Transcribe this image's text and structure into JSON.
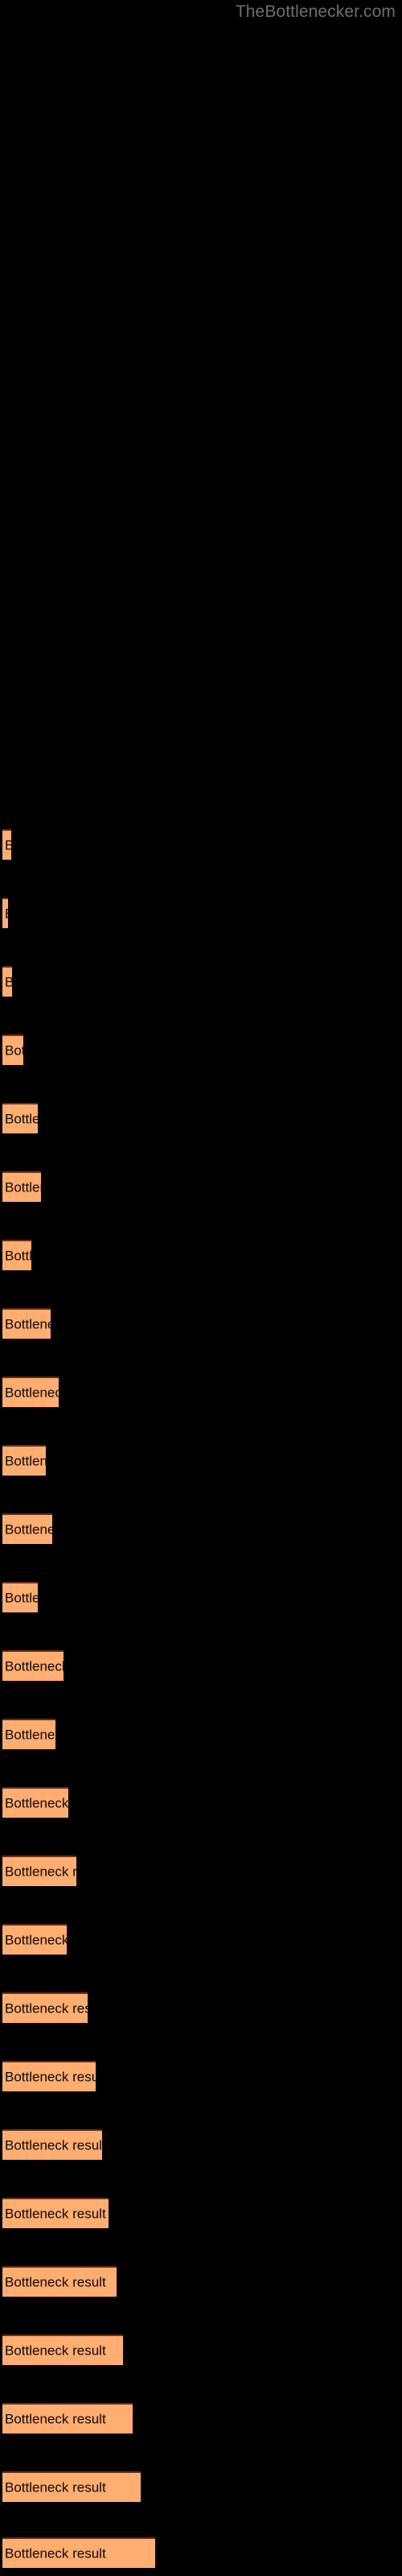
{
  "watermark": {
    "text": "TheBottlenecker.com",
    "color": "#6e6e6e"
  },
  "colors": {
    "background": "#000000",
    "bar_fill": "#ffad71",
    "bar_border_top": "#6b2f10",
    "bar_label_text": "#0a0a0a",
    "watermark_text": "#6e6e6e"
  },
  "chart_data": {
    "type": "bar",
    "orientation": "horizontal",
    "title": "",
    "subtitle": "",
    "xlabel": "",
    "ylabel": "",
    "grid": false,
    "legend": false,
    "legend_position": "none",
    "axis_visible": false,
    "tick_labels_visible": false,
    "bar_label_text": "Bottleneck result",
    "xlim": [
      0,
      500
    ],
    "categories": [
      "Bottleneck result",
      "Bottleneck result",
      "Bottleneck result",
      "Bottleneck result",
      "Bottleneck result",
      "Bottleneck result",
      "Bottleneck result",
      "Bottleneck result",
      "Bottleneck result",
      "Bottleneck result",
      "Bottleneck result",
      "Bottleneck result",
      "Bottleneck result",
      "Bottleneck result",
      "Bottleneck result",
      "Bottleneck result",
      "Bottleneck result",
      "Bottleneck result",
      "Bottleneck result",
      "Bottleneck result",
      "Bottleneck result",
      "Bottleneck result",
      "Bottleneck result",
      "Bottleneck result",
      "Bottleneck result",
      "Bottleneck result"
    ],
    "values": [
      11,
      7,
      12,
      26,
      44,
      48,
      36,
      60,
      70,
      54,
      62,
      44,
      76,
      66,
      82,
      92,
      80,
      106,
      116,
      124,
      132,
      142,
      150,
      162,
      172,
      190
    ],
    "bars": [
      {
        "index": 1,
        "label": "Bottleneck result",
        "width": 11,
        "top": 1030
      },
      {
        "index": 2,
        "label": "Bottleneck result",
        "width": 7,
        "top": 1115
      },
      {
        "index": 3,
        "label": "Bottleneck result",
        "width": 12,
        "top": 1200
      },
      {
        "index": 4,
        "label": "Bottleneck result",
        "width": 26,
        "top": 1285
      },
      {
        "index": 5,
        "label": "Bottleneck result",
        "width": 44,
        "top": 1370
      },
      {
        "index": 6,
        "label": "Bottleneck result",
        "width": 48,
        "top": 1455
      },
      {
        "index": 7,
        "label": "Bottleneck result",
        "width": 36,
        "top": 1540
      },
      {
        "index": 8,
        "label": "Bottleneck result",
        "width": 60,
        "top": 1625
      },
      {
        "index": 9,
        "label": "Bottleneck result",
        "width": 70,
        "top": 1710
      },
      {
        "index": 10,
        "label": "Bottleneck result",
        "width": 54,
        "top": 1795
      },
      {
        "index": 11,
        "label": "Bottleneck result",
        "width": 62,
        "top": 1880
      },
      {
        "index": 12,
        "label": "Bottleneck result",
        "width": 44,
        "top": 1965
      },
      {
        "index": 13,
        "label": "Bottleneck result",
        "width": 76,
        "top": 2050
      },
      {
        "index": 14,
        "label": "Bottleneck result",
        "width": 66,
        "top": 2135
      },
      {
        "index": 15,
        "label": "Bottleneck result",
        "width": 82,
        "top": 2220
      },
      {
        "index": 16,
        "label": "Bottleneck result",
        "width": 92,
        "top": 2305
      },
      {
        "index": 17,
        "label": "Bottleneck result",
        "width": 80,
        "top": 2390
      },
      {
        "index": 18,
        "label": "Bottleneck result",
        "width": 106,
        "top": 2475
      },
      {
        "index": 19,
        "label": "Bottleneck result",
        "width": 116,
        "top": 2560
      },
      {
        "index": 20,
        "label": "Bottleneck result",
        "width": 124,
        "top": 2645
      },
      {
        "index": 21,
        "label": "Bottleneck result",
        "width": 132,
        "top": 2730
      },
      {
        "index": 22,
        "label": "Bottleneck result",
        "width": 142,
        "top": 2815
      },
      {
        "index": 23,
        "label": "Bottleneck result",
        "width": 150,
        "top": 2900
      },
      {
        "index": 24,
        "label": "Bottleneck result",
        "width": 162,
        "top": 2985
      },
      {
        "index": 25,
        "label": "Bottleneck result",
        "width": 172,
        "top": 3070
      },
      {
        "index": 26,
        "label": "Bottleneck result",
        "width": 190,
        "top": 3152
      }
    ]
  }
}
